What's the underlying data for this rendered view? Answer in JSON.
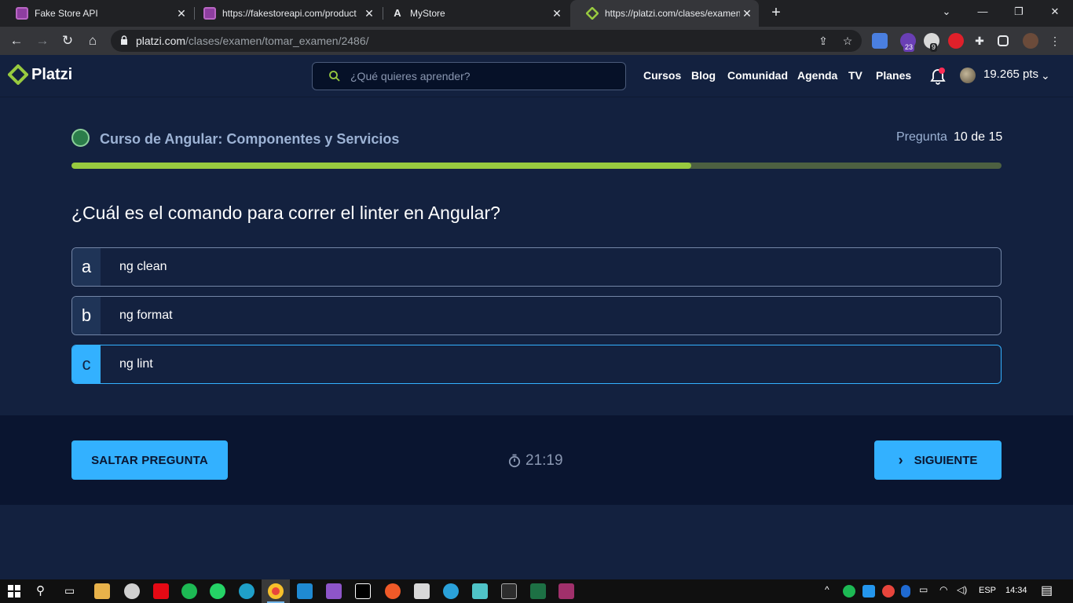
{
  "browser": {
    "tabs": [
      {
        "title": "Fake Store API",
        "icon": "fakestore-favicon",
        "active": false
      },
      {
        "title": "https://fakestoreapi.com/product",
        "icon": "fakestore-favicon",
        "active": false
      },
      {
        "title": "MyStore",
        "icon": "angular-favicon",
        "active": false
      },
      {
        "title": "https://platzi.com/clases/examen",
        "icon": "platzi-favicon",
        "active": true
      }
    ],
    "url_host": "platzi.com",
    "url_path": "/clases/examen/tomar_examen/2486/",
    "extension_badges": {
      "ext1": "23",
      "ext2": "9"
    }
  },
  "header": {
    "logo_text": "Platzi",
    "search_placeholder": "¿Qué quieres aprender?",
    "nav": [
      "Cursos",
      "Blog",
      "Comunidad",
      "Agenda",
      "TV",
      "Planes"
    ],
    "points": "19.265 pts"
  },
  "exam": {
    "course_title": "Curso de Angular: Componentes y Servicios",
    "question_label": "Pregunta",
    "question_progress": "10 de 15",
    "progress_fraction": 0.6667,
    "question": "¿Cuál es el comando para correr el linter en Angular?",
    "answers": [
      {
        "letter": "a",
        "text": "ng clean",
        "selected": false
      },
      {
        "letter": "b",
        "text": "ng format",
        "selected": false
      },
      {
        "letter": "c",
        "text": "ng lint",
        "selected": true
      }
    ]
  },
  "footer": {
    "skip_label": "SALTAR PREGUNTA",
    "timer": "21:19",
    "next_label": "SIGUIENTE"
  },
  "taskbar": {
    "language": "ESP",
    "time": "14:34"
  },
  "colors": {
    "accent": "#33b1ff",
    "progress": "#98ca3f",
    "background": "#13213f"
  }
}
